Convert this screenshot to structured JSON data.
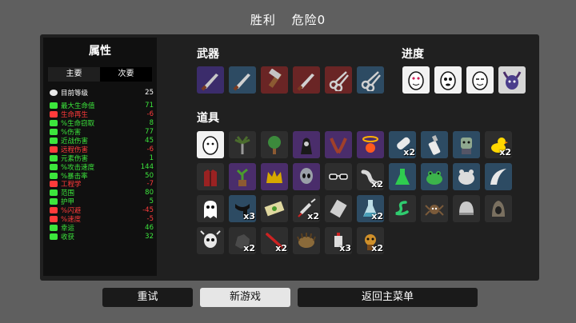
{
  "header": {
    "result": "胜利",
    "danger": "危险0"
  },
  "stats": {
    "title": "属性",
    "tabs": [
      "主要",
      "次要"
    ],
    "level": {
      "label": "目前等级",
      "value": "25"
    },
    "rows": [
      {
        "label": "最大生命值",
        "value": "71",
        "color": "#3ce63c",
        "icon": "heart-icon"
      },
      {
        "label": "生命再生",
        "value": "-6",
        "color": "#ff3b3b",
        "icon": "regen-icon"
      },
      {
        "label": "%生命窃取",
        "value": "8",
        "color": "#3ce63c",
        "icon": "lifesteal-icon"
      },
      {
        "label": "%伤害",
        "value": "77",
        "color": "#3ce63c",
        "icon": "damage-icon"
      },
      {
        "label": "近战伤害",
        "value": "45",
        "color": "#3ce63c",
        "icon": "melee-icon"
      },
      {
        "label": "远程伤害",
        "value": "-6",
        "color": "#ff3b3b",
        "icon": "ranged-icon"
      },
      {
        "label": "元素伤害",
        "value": "1",
        "color": "#3ce63c",
        "icon": "elemental-icon"
      },
      {
        "label": "%攻击速度",
        "value": "144",
        "color": "#3ce63c",
        "icon": "attack-speed-icon"
      },
      {
        "label": "%暴击率",
        "value": "50",
        "color": "#3ce63c",
        "icon": "crit-icon"
      },
      {
        "label": "工程学",
        "value": "-7",
        "color": "#ff3b3b",
        "icon": "engineering-icon"
      },
      {
        "label": "范围",
        "value": "80",
        "color": "#3ce63c",
        "icon": "range-icon"
      },
      {
        "label": "护甲",
        "value": "5",
        "color": "#3ce63c",
        "icon": "armor-icon"
      },
      {
        "label": "%闪避",
        "value": "-45",
        "color": "#ff3b3b",
        "icon": "dodge-icon"
      },
      {
        "label": "%速度",
        "value": "-5",
        "color": "#ff3b3b",
        "icon": "speed-icon"
      },
      {
        "label": "幸运",
        "value": "46",
        "color": "#3ce63c",
        "icon": "luck-icon"
      },
      {
        "label": "收获",
        "value": "32",
        "color": "#3ce63c",
        "icon": "harvest-icon"
      }
    ]
  },
  "weapons": {
    "title": "武器",
    "items": [
      {
        "icon": "knife-icon",
        "bg": "#3b2c6b",
        "fg": "#c8c8c8"
      },
      {
        "icon": "knife-icon",
        "bg": "#2d4b63",
        "fg": "#d0d0d0"
      },
      {
        "icon": "hammer-icon",
        "bg": "#6a2525",
        "fg": "#c4c4c4"
      },
      {
        "icon": "knife-icon",
        "bg": "#6a2525",
        "fg": "#d0d0d0"
      },
      {
        "icon": "scissors-icon",
        "bg": "#6a2525",
        "fg": "#d0d0d0"
      },
      {
        "icon": "scissors-icon",
        "bg": "#2d4b63",
        "fg": "#d0d0d0"
      }
    ]
  },
  "progress": {
    "title": "进度",
    "items": [
      {
        "icon": "egg-love-icon",
        "bg": "#f2f2f2"
      },
      {
        "icon": "egg-face-icon",
        "bg": "#f2f2f2"
      },
      {
        "icon": "egg-smile-icon",
        "bg": "#f2f2f2"
      },
      {
        "icon": "demon-mask-icon",
        "bg": "#d6d6d6"
      }
    ]
  },
  "items": {
    "title": "道具",
    "rows": [
      [
        {
          "icon": "egg-icon",
          "bg": "#f2f2f2",
          "count": ""
        },
        {
          "icon": "palm-tree-icon",
          "bg": "#2e2e2e",
          "count": ""
        },
        {
          "icon": "tree-icon",
          "bg": "#2e2e2e",
          "count": ""
        },
        {
          "icon": "hooded-figure-icon",
          "bg": "#4a2d6b",
          "count": ""
        },
        {
          "icon": "claws-icon",
          "bg": "#4a2d6b",
          "count": ""
        },
        {
          "icon": "halo-icon",
          "bg": "#4a2d6b",
          "count": ""
        },
        {
          "icon": "cast-leg-icon",
          "bg": "#2d4b63",
          "count": "x2"
        },
        {
          "icon": "bottle-icon",
          "bg": "#2d4b63",
          "count": ""
        },
        {
          "icon": "zombie-icon",
          "bg": "#2d4b63",
          "count": ""
        },
        {
          "icon": "duck-icon",
          "bg": "#2e2e2e",
          "count": "x2"
        }
      ],
      [
        {
          "icon": "jacket-icon",
          "bg": "#2e2e2e",
          "count": ""
        },
        {
          "icon": "plant-icon",
          "bg": "#4a2d6b",
          "count": ""
        },
        {
          "icon": "crown-icon",
          "bg": "#4a2d6b",
          "count": ""
        },
        {
          "icon": "alien-icon",
          "bg": "#4a2d6b",
          "count": ""
        },
        {
          "icon": "glasses-icon",
          "bg": "#2e2e2e",
          "count": ""
        },
        {
          "icon": "worm-icon",
          "bg": "#2e2e2e",
          "count": "x2"
        },
        {
          "icon": "potion-icon",
          "bg": "#2d4b63",
          "count": ""
        },
        {
          "icon": "frog-icon",
          "bg": "#2d4b63",
          "count": ""
        },
        {
          "icon": "bear-icon",
          "bg": "#2d4b63",
          "count": ""
        },
        {
          "icon": "horn-icon",
          "bg": "#2d4b63",
          "count": ""
        }
      ],
      [
        {
          "icon": "ghost-icon",
          "bg": "#2e2e2e",
          "count": ""
        },
        {
          "icon": "scarf-icon",
          "bg": "#2d4b63",
          "count": "x3"
        },
        {
          "icon": "cash-icon",
          "bg": "#2e2e2e",
          "count": ""
        },
        {
          "icon": "syringe-icon",
          "bg": "#2e2e2e",
          "count": "x2"
        },
        {
          "icon": "paper-icon",
          "bg": "#2e2e2e",
          "count": ""
        },
        {
          "icon": "flask-icon",
          "bg": "#2d4b63",
          "count": "x2"
        },
        {
          "icon": "snake-icon",
          "bg": "#2e2e2e",
          "count": ""
        },
        {
          "icon": "spider-icon",
          "bg": "#2e2e2e",
          "count": ""
        },
        {
          "icon": "helmet-icon",
          "bg": "#2e2e2e",
          "count": ""
        },
        {
          "icon": "hood-icon",
          "bg": "#2e2e2e",
          "count": ""
        }
      ],
      [
        {
          "icon": "skull-icon",
          "bg": "#2e2e2e",
          "count": ""
        },
        {
          "icon": "rock-icon",
          "bg": "#2e2e2e",
          "count": "x2"
        },
        {
          "icon": "stick-icon",
          "bg": "#2e2e2e",
          "count": "x2"
        },
        {
          "icon": "hedgehog-icon",
          "bg": "#2e2e2e",
          "count": ""
        },
        {
          "icon": "lamp-icon",
          "bg": "#2e2e2e",
          "count": "x3"
        },
        {
          "icon": "mascot-icon",
          "bg": "#2e2e2e",
          "count": "x2"
        }
      ]
    ]
  },
  "buttons": {
    "retry": "重试",
    "new_game": "新游戏",
    "main_menu": "返回主菜单"
  }
}
